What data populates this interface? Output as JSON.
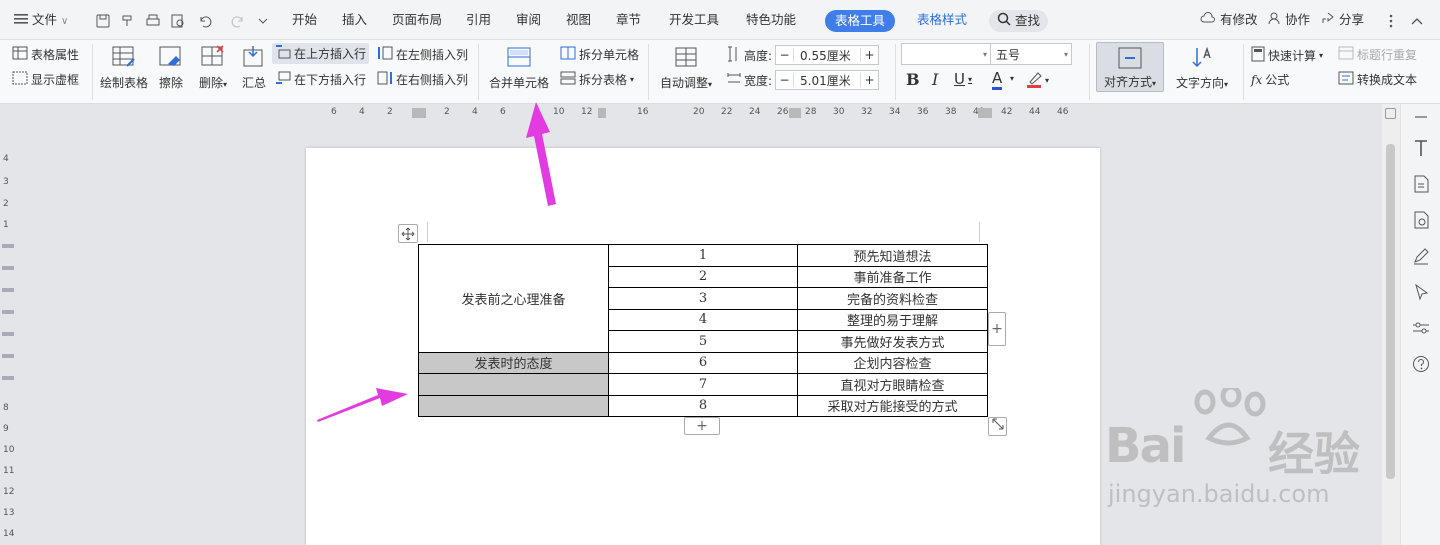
{
  "tabbar": {
    "file": "文件",
    "tabs": [
      "开始",
      "插入",
      "页面布局",
      "引用",
      "审阅",
      "视图",
      "章节",
      "开发工具",
      "特色功能"
    ],
    "active_tab": "表格工具",
    "style_tab": "表格样式",
    "search": "查找",
    "modified": "有修改",
    "collab": "协作",
    "share": "分享"
  },
  "ribbon": {
    "table_props": "表格属性",
    "show_grid": "显示虚框",
    "draw_table": "绘制表格",
    "erase": "擦除",
    "delete": "删除",
    "summary": "汇总",
    "insert_above": "在上方插入行",
    "insert_below": "在下方插入行",
    "insert_left": "在左侧插入列",
    "insert_right": "在右侧插入列",
    "merge_cells": "合并单元格",
    "split_cells": "拆分单元格",
    "split_table": "拆分表格",
    "auto_fit": "自动调整",
    "height_label": "高度:",
    "height_value": "0.55厘米",
    "width_label": "宽度:",
    "width_value": "5.01厘米",
    "font_size": "五号",
    "align": "对齐方式",
    "text_dir": "文字方向",
    "quick_calc": "快速计算",
    "formula": "公式",
    "header_repeat": "标题行重复",
    "to_text": "转换成文本"
  },
  "ruler": {
    "h_ticks": [
      "6",
      "4",
      "2",
      "2",
      "4",
      "6",
      "10",
      "12",
      "16",
      "20",
      "22",
      "24",
      "26",
      "28",
      "30",
      "32",
      "34",
      "36",
      "38",
      "40",
      "42",
      "44",
      "46"
    ],
    "v_ticks": [
      "4",
      "3",
      "2",
      "1",
      "8",
      "9",
      "10",
      "11",
      "12",
      "13",
      "14"
    ]
  },
  "table": {
    "merged_label": "发表前之心理准备",
    "attitude_label": "发表时的态度",
    "rows": [
      {
        "num": "1",
        "text": "预先知道想法"
      },
      {
        "num": "2",
        "text": "事前准备工作"
      },
      {
        "num": "3",
        "text": "完备的资料检查"
      },
      {
        "num": "4",
        "text": "整理的易于理解"
      },
      {
        "num": "5",
        "text": "事先做好发表方式"
      },
      {
        "num": "6",
        "text": "企划内容检查"
      },
      {
        "num": "7",
        "text": "直视对方眼睛检查"
      },
      {
        "num": "8",
        "text": "采取对方能接受的方式"
      }
    ]
  },
  "watermark": {
    "brand": "Bai",
    "brand2": "经验",
    "url": "jingyan.baidu.com"
  },
  "colors": {
    "accent": "#3f7de8",
    "arrow": "#e23be0",
    "cell_grey": "#c8c8c8"
  }
}
